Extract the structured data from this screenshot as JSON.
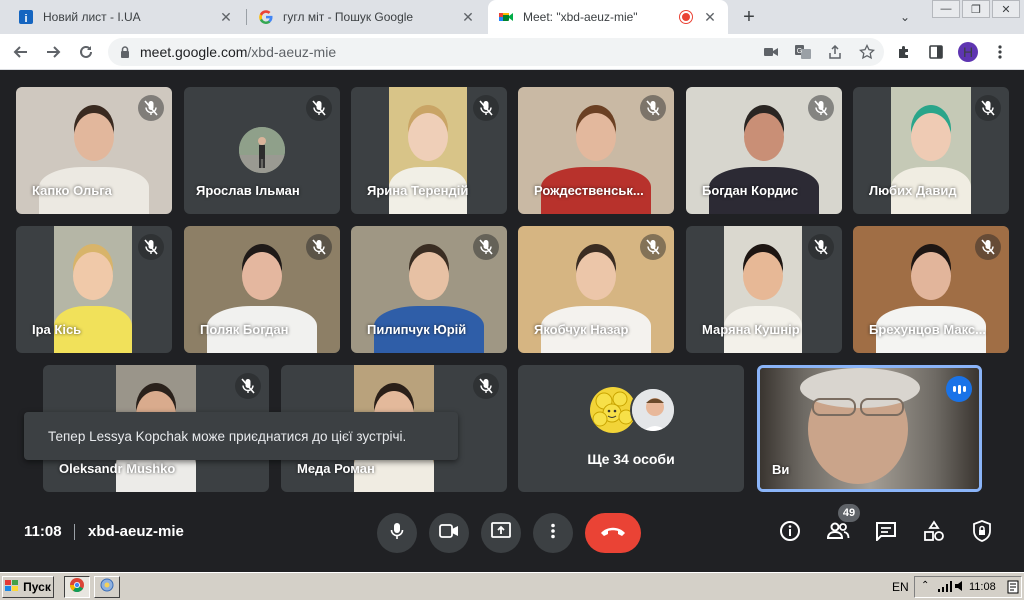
{
  "browser": {
    "tabs": [
      {
        "title": "Новий лист - I.UA",
        "active": false
      },
      {
        "title": "гугл міт - Пошук Google",
        "active": false
      },
      {
        "title": "Meet: \"xbd-aeuz-mie\"",
        "active": true
      }
    ],
    "url_host": "meet.google.com",
    "url_path": "/xbd-aeuz-mie",
    "profile_initial": "H"
  },
  "meeting": {
    "participants": [
      {
        "name": "Капко Ольга"
      },
      {
        "name": "Ярослав Ільман"
      },
      {
        "name": "Ярина Терендій"
      },
      {
        "name": "Рождественськ..."
      },
      {
        "name": "Богдан Кордис"
      },
      {
        "name": "Любих Давид"
      },
      {
        "name": "Іра Кісь"
      },
      {
        "name": "Поляк Богдан"
      },
      {
        "name": "Пилипчук Юрій"
      },
      {
        "name": "Якобчук Назар"
      },
      {
        "name": "Маряна Кушнір"
      },
      {
        "name": "Брехунцов Макс..."
      },
      {
        "name": "Oleksandr Mushko"
      },
      {
        "name": "Меда Роман"
      }
    ],
    "others_label": "Ще 34 особи",
    "self_label": "Ви",
    "toast": "Тепер Lessya Kopchak може приєднатися до цієї зустрічі.",
    "time": "11:08",
    "meeting_code": "xbd-aeuz-mie",
    "people_count": "49"
  },
  "taskbar": {
    "start_label": "Пуск",
    "language": "EN",
    "clock": "11:08"
  },
  "colors": {
    "meet_bg": "#202124",
    "tile_bg": "#3c4043",
    "end_call": "#ea4335",
    "active_speaker_border": "#8ab4f8",
    "speaking_badge": "#1a73e8"
  }
}
